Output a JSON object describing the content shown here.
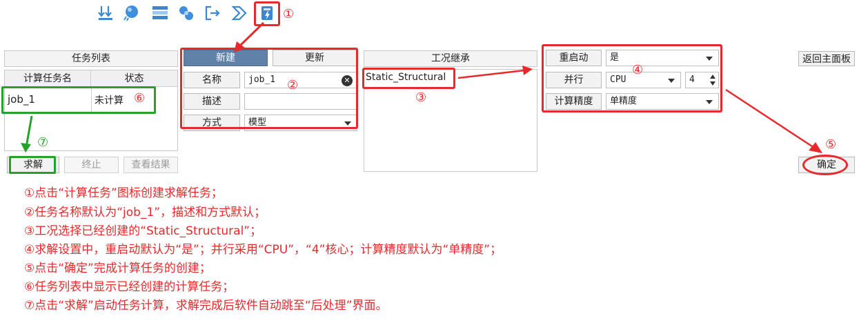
{
  "toolbar": {
    "icons": [
      "load-icon",
      "material-ball-icon",
      "mesh-icon",
      "contact-icon",
      "export-icon",
      "step-icon",
      "compute-task-icon"
    ],
    "highlight_marker": "①"
  },
  "task_list": {
    "header": "任务列表",
    "columns": [
      "计算任务名",
      "状态"
    ],
    "rows": [
      {
        "name": "job_1",
        "status": "未计算"
      }
    ],
    "row_marker": "⑥",
    "buttons": {
      "solve": "求解",
      "stop": "终止",
      "view": "查看结果"
    },
    "solve_marker": "⑦"
  },
  "task_form": {
    "new_label": "新建",
    "update_label": "更新",
    "name_label": "名称",
    "name_value": "job_1",
    "desc_label": "描述",
    "desc_value": "",
    "method_label": "方式",
    "method_value": "模型",
    "marker": "②"
  },
  "case_inherit": {
    "header": "工况继承",
    "item": "Static_Structural",
    "marker": "③"
  },
  "solve_settings": {
    "restart_label": "重启动",
    "restart_value": "是",
    "parallel_label": "并行",
    "parallel_value": "CPU",
    "cores_value": "4",
    "precision_label": "计算精度",
    "precision_value": "单精度",
    "marker": "④"
  },
  "right": {
    "home_label": "返回主面板",
    "confirm_label": "确定",
    "confirm_marker": "⑤"
  },
  "notes": [
    "①点击“计算任务”图标创建求解任务；",
    "②任务名称默认为“job_1”，描述和方式默认；",
    "③工况选择已经创建的“Static_Structural”；",
    "④求解设置中，重启动默认为“是”；并行采用“CPU”，“4”核心；计算精度默认为“单精度”；",
    "⑤点击“确定”完成计算任务的创建；",
    "⑥任务列表中显示已经创建的计算任务；",
    "⑦点击“求解”启动任务计算，求解完成后软件自动跳至“后处理”界面。"
  ],
  "colors": {
    "annotation_red": "#e8292b",
    "annotation_green": "#23a32a",
    "primary_button": "#6082a8",
    "icon_blue": "#2a7fd4"
  }
}
